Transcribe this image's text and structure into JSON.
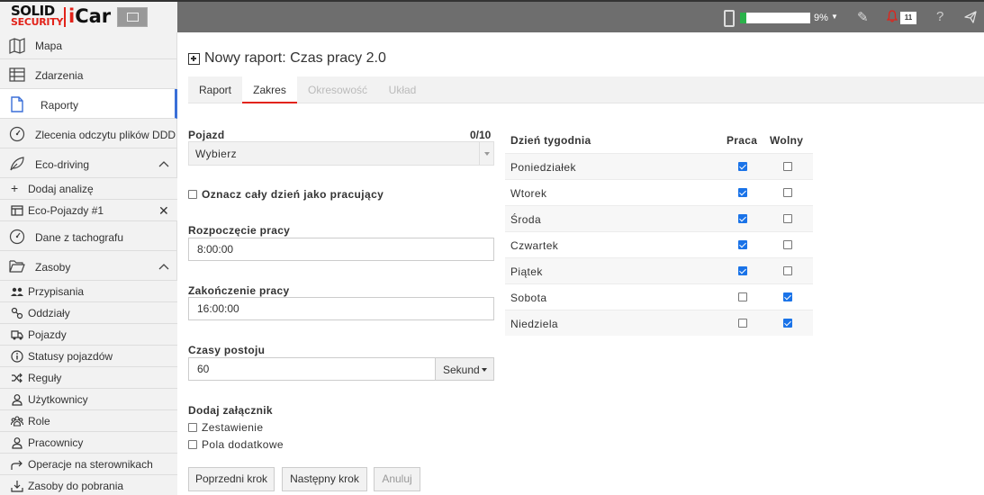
{
  "header": {
    "logo_solid": "SOLID",
    "logo_security": "SECURITY",
    "logo_icar_i": "i",
    "logo_icar_rest": "Car",
    "progress_percent": 9,
    "progress_text": "9%",
    "notifications_count": "11",
    "colors": {
      "bar": "#6e6e6e",
      "progress": "#2ab24a",
      "brand_red": "#e2231a"
    }
  },
  "sidebar": {
    "items": [
      {
        "label": "Mapa",
        "icon": "map-icon"
      },
      {
        "label": "Zdarzenia",
        "icon": "table-icon"
      },
      {
        "label": "Raporty",
        "icon": "document-icon",
        "active": true
      },
      {
        "label": "Zlecenia odczytu plików DDD",
        "icon": "tachograph-icon"
      },
      {
        "label": "Eco-driving",
        "icon": "leaf-icon"
      },
      {
        "label": "Dane z tachografu",
        "icon": "tachograph-icon"
      },
      {
        "label": "Zasoby",
        "icon": "folder-open-icon"
      }
    ],
    "eco_sub": [
      {
        "label": "Dodaj analizę",
        "icon": "plus-icon"
      },
      {
        "label": "Eco-Pojazdy #1",
        "icon": "table-icon"
      }
    ],
    "zasoby_sub": [
      {
        "label": "Przypisania",
        "icon": "users-link-icon"
      },
      {
        "label": "Oddziały",
        "icon": "branches-icon"
      },
      {
        "label": "Pojazdy",
        "icon": "truck-icon"
      },
      {
        "label": "Statusy pojazdów",
        "icon": "info-icon"
      },
      {
        "label": "Reguły",
        "icon": "shuffle-icon"
      },
      {
        "label": "Użytkownicy",
        "icon": "user-icon"
      },
      {
        "label": "Role",
        "icon": "group-icon"
      },
      {
        "label": "Pracownicy",
        "icon": "user-icon"
      },
      {
        "label": "Operacje na sterownikach",
        "icon": "share-icon"
      },
      {
        "label": "Zasoby do pobrania",
        "icon": "download-icon"
      }
    ]
  },
  "main": {
    "title": "Nowy raport: Czas pracy 2.0",
    "tabs": [
      {
        "label": "Raport",
        "state": "normal"
      },
      {
        "label": "Zakres",
        "state": "active"
      },
      {
        "label": "Okresowość",
        "state": "disabled"
      },
      {
        "label": "Układ",
        "state": "disabled"
      }
    ],
    "form": {
      "vehicle_label": "Pojazd",
      "vehicle_counter": "0/10",
      "vehicle_value": "Wybierz",
      "whole_day_label": "Oznacz cały dzień jako pracujący",
      "start_label": "Rozpoczęcie pracy",
      "start_value": "8:00:00",
      "end_label": "Zakończenie pracy",
      "end_value": "16:00:00",
      "idle_label": "Czasy postoju",
      "idle_value": "60",
      "idle_unit": "Sekund",
      "attach_label": "Dodaj załącznik",
      "attach_summary": "Zestawienie",
      "attach_fields": "Pola dodatkowe"
    },
    "buttons": {
      "prev": "Poprzedni krok",
      "next": "Następny krok",
      "cancel": "Anuluj"
    },
    "week": {
      "head_day": "Dzień tygodnia",
      "head_work": "Praca",
      "head_free": "Wolny",
      "days": [
        {
          "name": "Poniedziałek",
          "work": true,
          "free": false
        },
        {
          "name": "Wtorek",
          "work": true,
          "free": false
        },
        {
          "name": "Środa",
          "work": true,
          "free": false
        },
        {
          "name": "Czwartek",
          "work": true,
          "free": false
        },
        {
          "name": "Piątek",
          "work": true,
          "free": false
        },
        {
          "name": "Sobota",
          "work": false,
          "free": true
        },
        {
          "name": "Niedziela",
          "work": false,
          "free": true
        }
      ]
    }
  }
}
